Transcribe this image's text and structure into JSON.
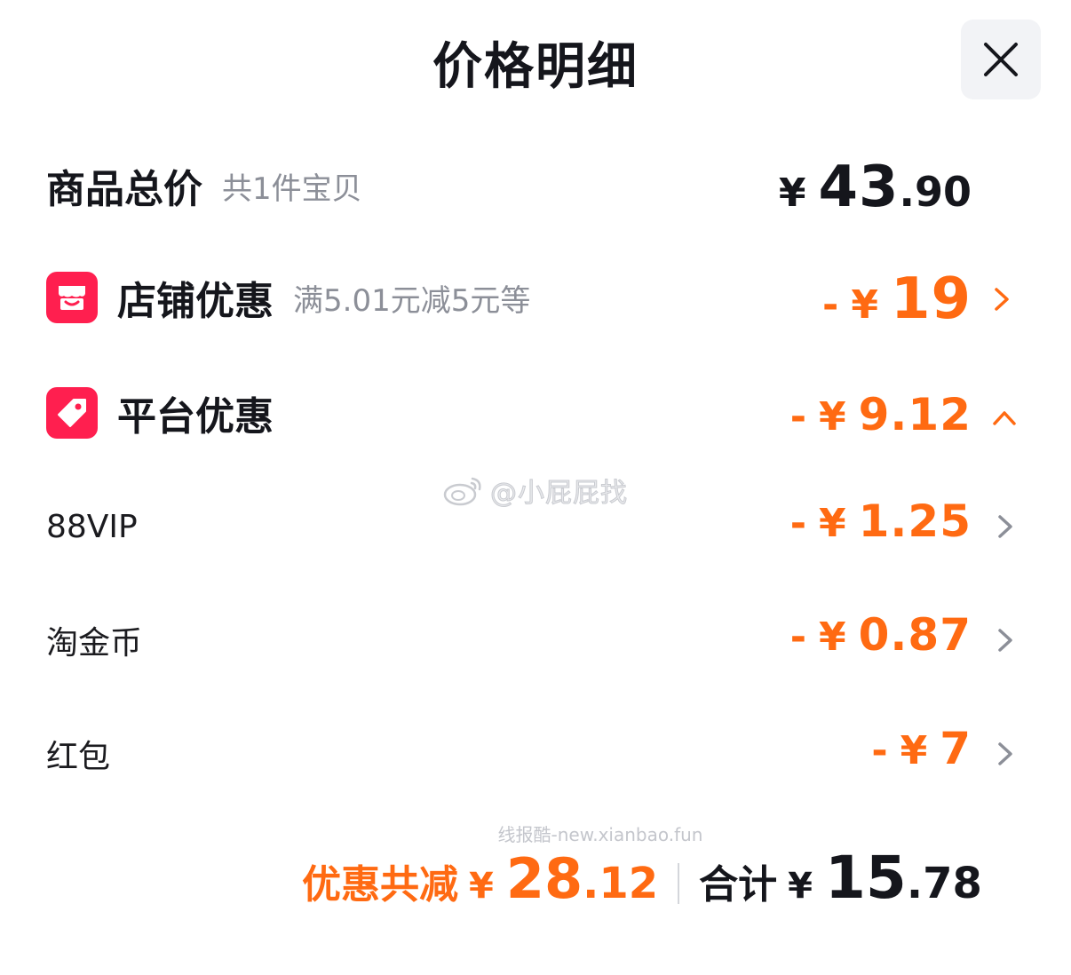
{
  "header": {
    "title": "价格明细",
    "close_icon": "close-icon"
  },
  "rows": {
    "goods": {
      "label": "商品总价",
      "sub": "共1件宝贝",
      "yen": "¥",
      "int": "43",
      "cents": ".90"
    },
    "shop": {
      "icon": "shop-icon",
      "label": "店铺优惠",
      "sub": "满5.01元减5元等",
      "minus": "-",
      "yen": "¥",
      "int": "19",
      "chevron": "chevron-right-icon"
    },
    "platform": {
      "icon": "tag-icon",
      "label": "平台优惠",
      "minus": "-",
      "yen": "¥",
      "int": "9.12",
      "chevron": "chevron-up-icon"
    },
    "vip": {
      "label": "88VIP",
      "minus": "-",
      "yen": "¥",
      "int": "1.25",
      "chevron": "chevron-right-icon"
    },
    "coins": {
      "label": "淘金币",
      "minus": "-",
      "yen": "¥",
      "int": "0.87",
      "chevron": "chevron-right-icon"
    },
    "redpacket": {
      "label": "红包",
      "minus": "-",
      "yen": "¥",
      "int": "7",
      "chevron": "chevron-right-icon"
    }
  },
  "watermark": {
    "text": "@小屁屁找",
    "icon": "weibo-icon"
  },
  "footer_mark": "线报酷-new.xianbao.fun",
  "summary": {
    "discount_label": "优惠共减",
    "discount_yen": "¥",
    "discount_int": "28",
    "discount_cents": ".12",
    "total_label": "合计",
    "total_yen": "¥",
    "total_int": "15",
    "total_cents": ".78"
  },
  "colors": {
    "accent": "#ff6a12",
    "badge": "#ff1f4f",
    "text": "#15161c",
    "muted": "#8c8f98"
  }
}
